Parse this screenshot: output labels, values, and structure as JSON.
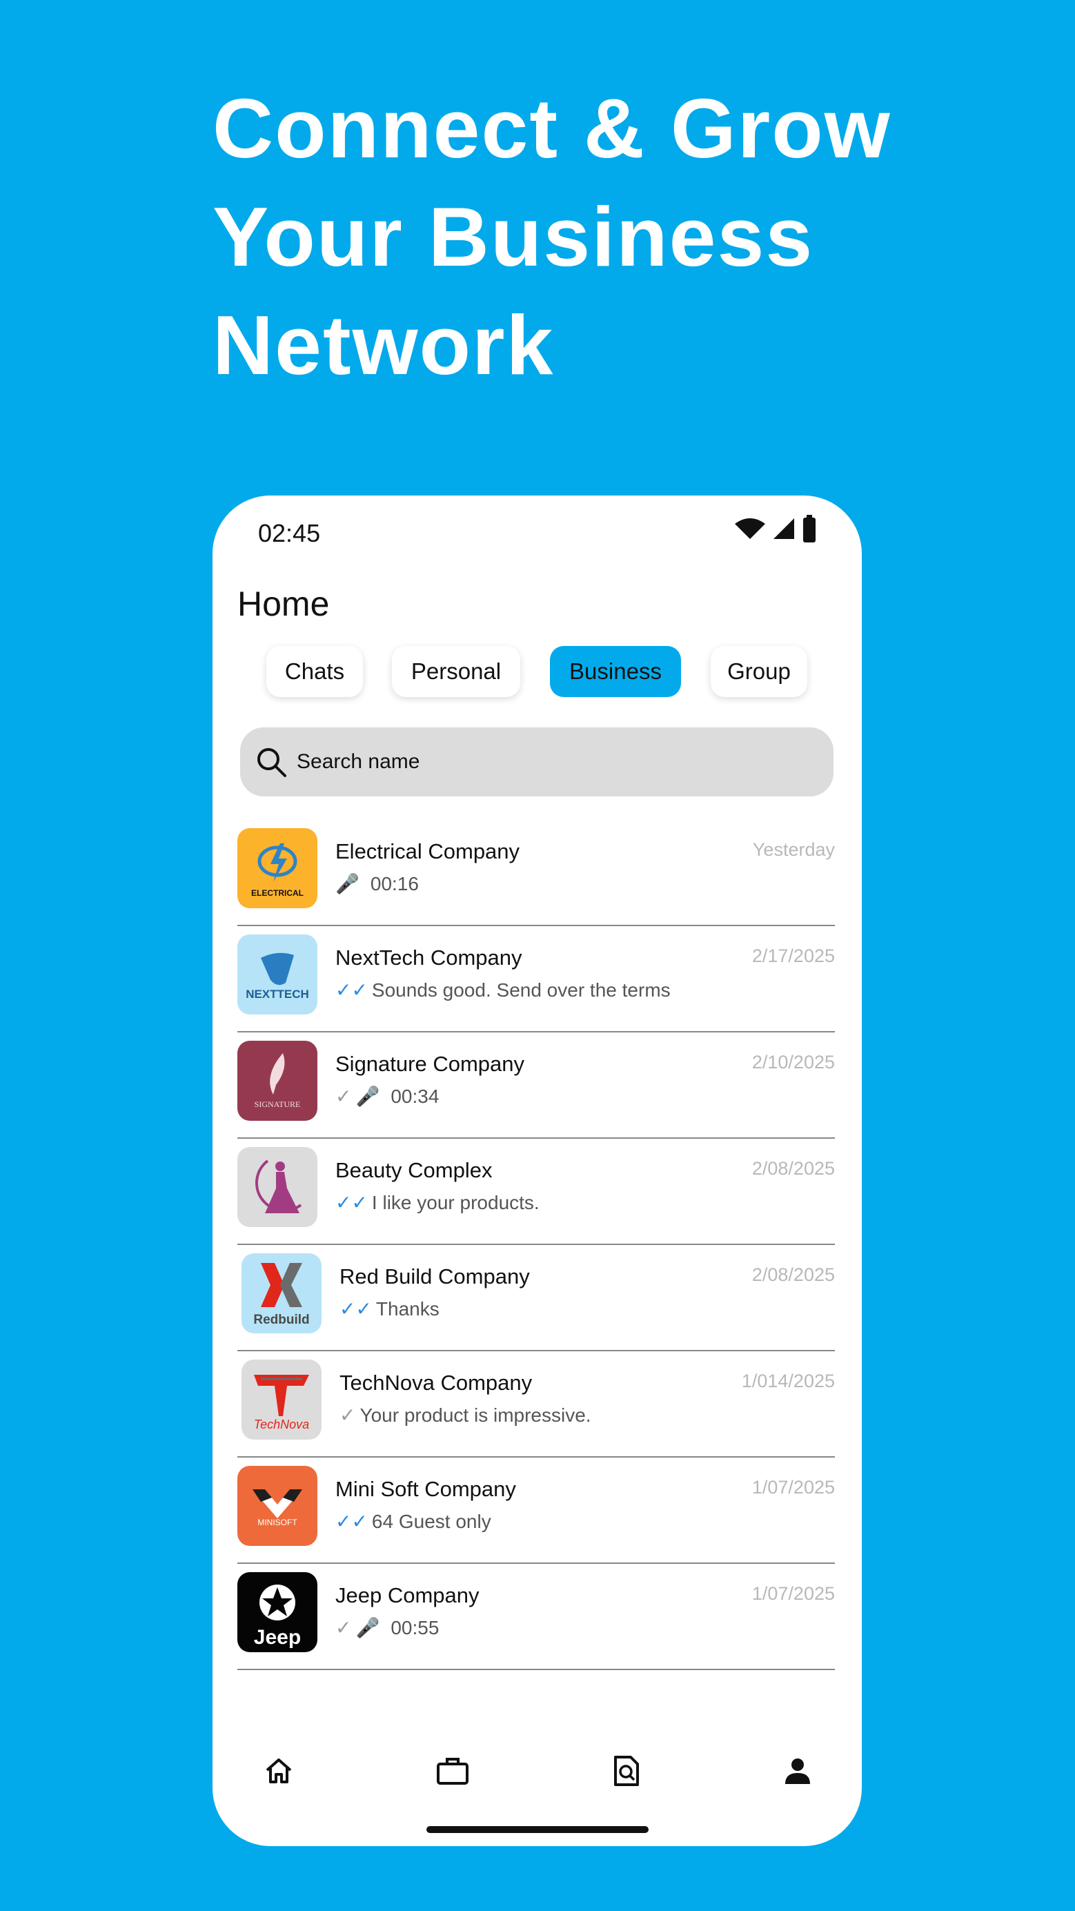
{
  "headline": {
    "line1": "Connect & Grow",
    "line2": "Your Business",
    "line3": "Network"
  },
  "status_bar": {
    "time": "02:45",
    "icons": [
      "wifi-icon",
      "signal-icon",
      "battery-icon"
    ]
  },
  "header": {
    "title": "Home"
  },
  "tabs": [
    {
      "label": "Chats",
      "active": false
    },
    {
      "label": "Personal",
      "active": false
    },
    {
      "label": "Business",
      "active": true
    },
    {
      "label": "Group",
      "active": false
    }
  ],
  "search": {
    "placeholder": "Search name",
    "value": ""
  },
  "chats": [
    {
      "name": "Electrical Company",
      "preview": "00:16",
      "type": "voice",
      "status": "none",
      "date": "Yesterday",
      "logo_text": "ELECTRICAL"
    },
    {
      "name": "NextTech Company",
      "preview": "Sounds good. Send over the terms",
      "type": "text",
      "status": "read",
      "date": "2/17/2025",
      "logo_text": "NEXTTECH"
    },
    {
      "name": "Signature Company",
      "preview": "00:34",
      "type": "voice",
      "status": "sent",
      "date": "2/10/2025",
      "logo_text": "SIGNATURE"
    },
    {
      "name": "Beauty Complex",
      "preview": "I like your products.",
      "type": "text",
      "status": "read",
      "date": "2/08/2025",
      "logo_text": ""
    },
    {
      "name": "Red Build Company",
      "preview": "Thanks",
      "type": "text",
      "status": "read",
      "date": "2/08/2025",
      "logo_text": "Redbuild"
    },
    {
      "name": "TechNova Company",
      "preview": "Your product is impressive.",
      "type": "text",
      "status": "sent",
      "date": "1/014/2025",
      "logo_text": "TechNova"
    },
    {
      "name": "Mini Soft Company",
      "preview": "64 Guest only",
      "type": "text",
      "status": "read",
      "date": "1/07/2025",
      "logo_text": "MINISOFT"
    },
    {
      "name": "Jeep Company",
      "preview": "00:55",
      "type": "voice",
      "status": "sent",
      "date": "1/07/2025",
      "logo_text": "Jeep"
    }
  ],
  "bottom_nav": [
    "home-icon",
    "briefcase-icon",
    "document-search-icon",
    "profile-icon"
  ],
  "colors": {
    "background": "#03AAEB",
    "accent": "#03AAEB",
    "read_tick": "#2A8BE0"
  }
}
